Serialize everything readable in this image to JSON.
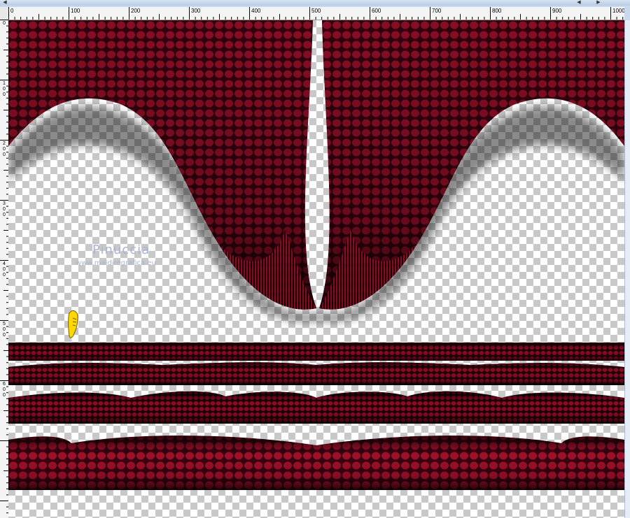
{
  "ruler": {
    "horizontal_ticks": [
      "0",
      "100",
      "200",
      "300",
      "400",
      "500",
      "600",
      "700",
      "800",
      "900",
      "1000"
    ],
    "vertical_ticks": [
      "0",
      "100",
      "200",
      "300",
      "400",
      "500",
      "600"
    ]
  },
  "watermark": {
    "title": "Pinuccia",
    "url": "www.maidiregrafica.eu"
  },
  "colors": {
    "crimson": "#a0102a",
    "dark_red": "#2a0008",
    "checker": "#c8c8c8",
    "ruler_bg": "#f4f4f4",
    "cursor_yellow": "#ffd800"
  },
  "cursor_icon": "pointing-hand-icon"
}
